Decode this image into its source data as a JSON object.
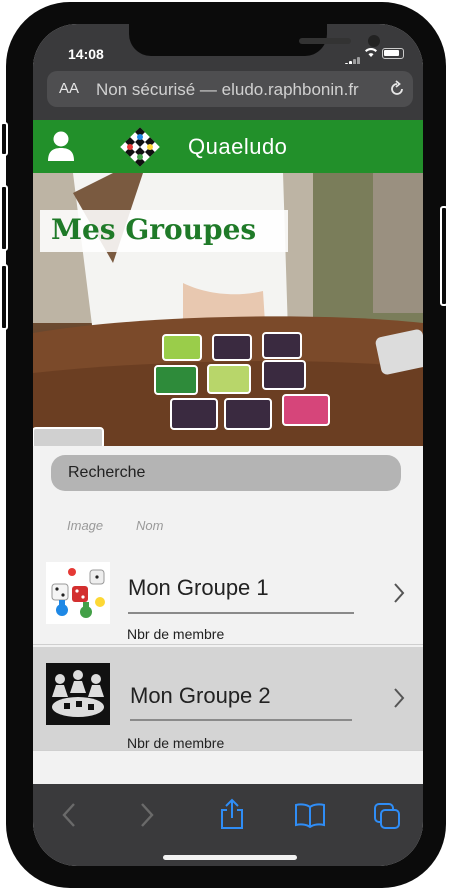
{
  "status_bar": {
    "time": "14:08"
  },
  "browser": {
    "text_size_label": "AA",
    "url_text": "Non sécurisé — eludo.raphbonin.fr"
  },
  "app": {
    "title": "Quaeludo"
  },
  "hero": {
    "title": "Mes Groupes"
  },
  "search": {
    "label": "Recherche"
  },
  "columns": {
    "image": "Image",
    "name": "Nom"
  },
  "groups": [
    {
      "name": "Mon Groupe 1",
      "subtitle": "Nbr de membre"
    },
    {
      "name": "Mon Groupe 2",
      "subtitle": "Nbr de membre"
    }
  ],
  "colors": {
    "header_green": "#22902a",
    "title_green": "#1f7a28",
    "safari_bar": "#3a3a3c",
    "ios_blue": "#2f8df6"
  },
  "icons": [
    "user-icon",
    "logo-icon",
    "reload-icon",
    "chevron-right-icon",
    "back-icon",
    "forward-icon",
    "share-icon",
    "bookmarks-icon",
    "tabs-icon"
  ]
}
